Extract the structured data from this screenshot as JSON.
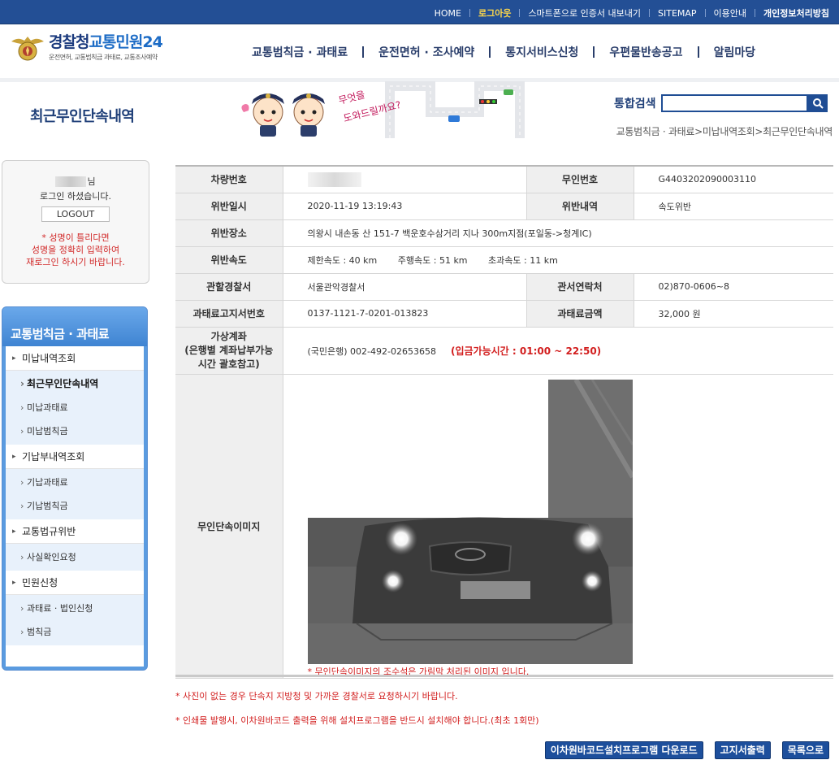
{
  "topnav": {
    "home": "HOME",
    "logout": "로그아웃",
    "cert_export": "스마트폰으로 인증서 내보내기",
    "sitemap": "SITEMAP",
    "guide": "이용안내",
    "privacy": "개인정보처리방침"
  },
  "header": {
    "logo_part1": "경찰청",
    "logo_part2": "교통민원24",
    "logo_sub": "운전면허, 교통범칙금 과태료, 교통조사예약",
    "gnb": [
      "교통범칙금 · 과태료",
      "운전면허 · 조사예약",
      "통지서비스신청",
      "우편물반송공고",
      "알림마당"
    ]
  },
  "titleband": {
    "page_title": "최근무인단속내역",
    "illus_text": "무엇을 도와드릴까요?",
    "search_label": "통합검색",
    "search_value": "",
    "breadcrumb": "교통범칙금 · 과태료>미납내역조회>최근무인단속내역"
  },
  "login": {
    "suffix": "님",
    "msg": "로그인 하셨습니다.",
    "logout_btn": "LOGOUT",
    "warn1": "* 성명이 틀리다면",
    "warn2": "성명을 정확히 입력하여",
    "warn3": "재로그인 하시기 바랍니다."
  },
  "side": {
    "head": "교통범칙금 · 과태료",
    "groups": [
      {
        "label": "미납내역조회",
        "subs": [
          "최근무인단속내역",
          "미납과태료",
          "미납범칙금"
        ]
      },
      {
        "label": "기납부내역조회",
        "subs": [
          "기납과태료",
          "기납범칙금"
        ]
      },
      {
        "label": "교통법규위반",
        "subs": [
          "사실확인요청"
        ]
      },
      {
        "label": "민원신청",
        "subs": [
          "과태료 · 법인신청",
          "범칙금"
        ]
      }
    ]
  },
  "detail": {
    "vehicle_no_label": "차량번호",
    "unmanned_no_label": "무인번호",
    "unmanned_no": "G4403202090003110",
    "date_label": "위반일시",
    "date": "2020-11-19 13:19:43",
    "type_label": "위반내역",
    "type": "속도위반",
    "place_label": "위반장소",
    "place": "의왕시 내손동 산 151-7 백운호수삼거리 지나 300m지점(포일동->청계IC)",
    "speed_label": "위반속도",
    "speed_limit": "제한속도 : 40 km",
    "speed_driving": "주행속도 : 51 km",
    "speed_over": "초과속도 : 11 km",
    "police_label": "관할경찰서",
    "police": "서울관악경찰서",
    "contact_label": "관서연락처",
    "contact": "02)870-0606~8",
    "notice_no_label": "과태료고지서번호",
    "notice_no": "0137-1121-7-0201-013823",
    "amount_label": "과태료금액",
    "amount": "32,000 원",
    "vaccount_label1": "가상계좌",
    "vaccount_label2": "(은행별 계좌납부가능",
    "vaccount_label3": "시간 괄호참고)",
    "vaccount": "(국민은행) 002-492-02653658",
    "vaccount_time": "(입금가능시간 : 01:00 ~ 22:50)",
    "image_label": "무인단속이미지",
    "image_note": "* 무인단속이미지의 조수석은 가림막 처리된 이미지 입니다."
  },
  "notes": [
    "* 사진이 없는 경우 단속지 지방청 및 가까운 경찰서로 요청하시기 바랍니다.",
    "* 인쇄물 발행시, 이차원바코드 출력을 위해 설치프로그램을 반드시 설치해야 합니다.(최초 1회만)"
  ],
  "buttons": {
    "download": "이차원바코드설치프로그램 다운로드",
    "print": "고지서출력",
    "list": "목록으로"
  }
}
